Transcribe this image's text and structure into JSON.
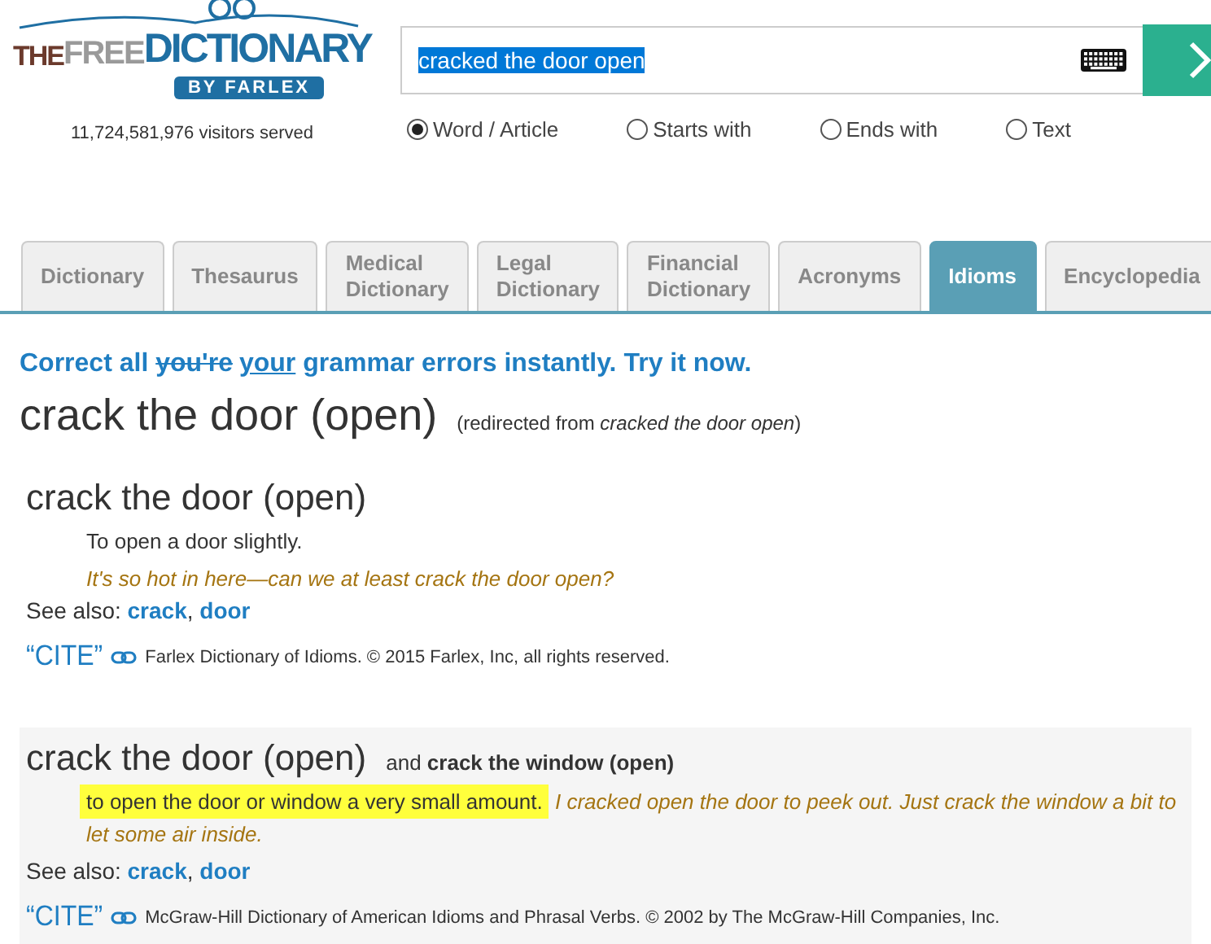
{
  "logo": {
    "word_1": "THE",
    "word_2": "FREE",
    "word_3": "DICTIONARY",
    "byline": "BY FARLEX"
  },
  "visitors": "11,724,581,976 visitors served",
  "search": {
    "value": "cracked the door open",
    "selected_text": true
  },
  "search_modes": [
    {
      "label": "Word / Article",
      "selected": true
    },
    {
      "label": "Starts with",
      "selected": false
    },
    {
      "label": "Ends with",
      "selected": false
    },
    {
      "label": "Text",
      "selected": false
    }
  ],
  "tabs": [
    {
      "label": "Dictionary",
      "selected": false
    },
    {
      "label": "Thesaurus",
      "selected": false
    },
    {
      "label": "Medical Dictionary",
      "selected": false
    },
    {
      "label": "Legal Dictionary",
      "selected": false
    },
    {
      "label": "Financial Dictionary",
      "selected": false
    },
    {
      "label": "Acronyms",
      "selected": false
    },
    {
      "label": "Idioms",
      "selected": true
    },
    {
      "label": "Encyclopedia",
      "selected": false
    }
  ],
  "promo": [
    {
      "text": "Correct all ",
      "kind": "plain"
    },
    {
      "text": "you're",
      "kind": "struck"
    },
    {
      "text": "your",
      "kind": "underlined"
    },
    {
      "text": " grammar errors instantly. Try it now.",
      "kind": "plain"
    }
  ],
  "title": "crack the door (open)",
  "redirect": "(redirected from *cracked the door open*)",
  "entries": [
    {
      "headword": "crack the door (open)",
      "shaded": false,
      "kind": "block",
      "definition": "To open a door slightly.",
      "highlighted": false,
      "example": "It's so hot in here—can we at least crack the door open?",
      "see_also_label": "See also:",
      "see_also": [
        "crack",
        "door"
      ],
      "see_also_separator": ",",
      "cite": "“CITE”",
      "source": "Farlex Dictionary of Idioms. © 2015 Farlex, Inc, all rights reserved."
    },
    {
      "headword": "crack the door (open)",
      "variant_prefix": "and",
      "variant": "crack the window (open)",
      "shaded": true,
      "kind": "inline",
      "definition": "to open the door or window a very small amount.",
      "highlighted": true,
      "example": "I cracked open the door to peek out. Just crack the window a bit to let some air inside.",
      "see_also_label": "See also:",
      "see_also": [
        "crack",
        "door"
      ],
      "see_also_separator": ",",
      "cite": "“CITE”",
      "source": "McGraw-Hill Dictionary of American Idioms and Phrasal Verbs. © 2002 by The McGraw-Hill Companies, Inc."
    }
  ]
}
